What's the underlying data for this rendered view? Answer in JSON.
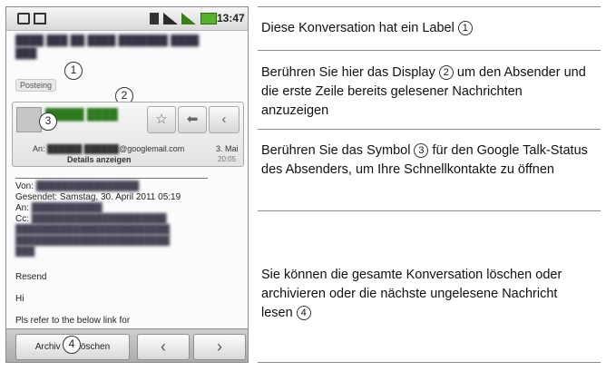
{
  "phone": {
    "status_bar": {
      "time": "13:47"
    },
    "label_tag": "Posteing",
    "sender_card": {
      "an_prefix": "An:",
      "an_domain": "@googlemail.com",
      "date": "3. Mai",
      "time": "20:05",
      "details_link": "Details anzeigen",
      "star_symbol": "☆",
      "reply_symbol": "⬅",
      "more_symbol": "‹"
    },
    "quoted": {
      "von": "Von:",
      "gesendet": "Gesendet: Samstag, 30. April 2011 05:19",
      "an": "An:",
      "cc": "Cc:",
      "resend": "Resend",
      "hi": "Hi",
      "link_line": "Pls refer to the below link for"
    },
    "bottom_bar": {
      "archive_label_left": "Archiv",
      "archive_label_right": "Löschen",
      "prev_symbol": "‹",
      "next_symbol": "›"
    },
    "callouts": [
      "1",
      "2",
      "3",
      "4"
    ]
  },
  "table": {
    "rows": [
      {
        "text": "Diese Konversation hat ein Label",
        "marker": "1"
      },
      {
        "text_before": "Berühren Sie hier das Display ",
        "marker": "2",
        "text_after": "um den Absender und die erste Zeile bereits gelesener Nachrichten anzuzeigen"
      },
      {
        "text_before": "Berühren Sie das Symbol ",
        "marker": "3",
        "text_after": "für den Google Talk-Status des Absenders, um Ihre Schnellkontakte zu öffnen"
      },
      {
        "text": "Sie können die gesamte Konversation löschen oder archivieren oder die nächste ungelesene Nachricht lesen",
        "marker": "4"
      }
    ]
  },
  "icons": [
    "usb-icon",
    "message-icon",
    "sd-card-icon",
    "signal-icon",
    "battery-icon",
    "star-icon",
    "reply-icon",
    "more-icon",
    "prev-icon",
    "next-icon"
  ],
  "colors": {
    "sender_name": "#2f7a1f",
    "battery": "#55b22b"
  }
}
